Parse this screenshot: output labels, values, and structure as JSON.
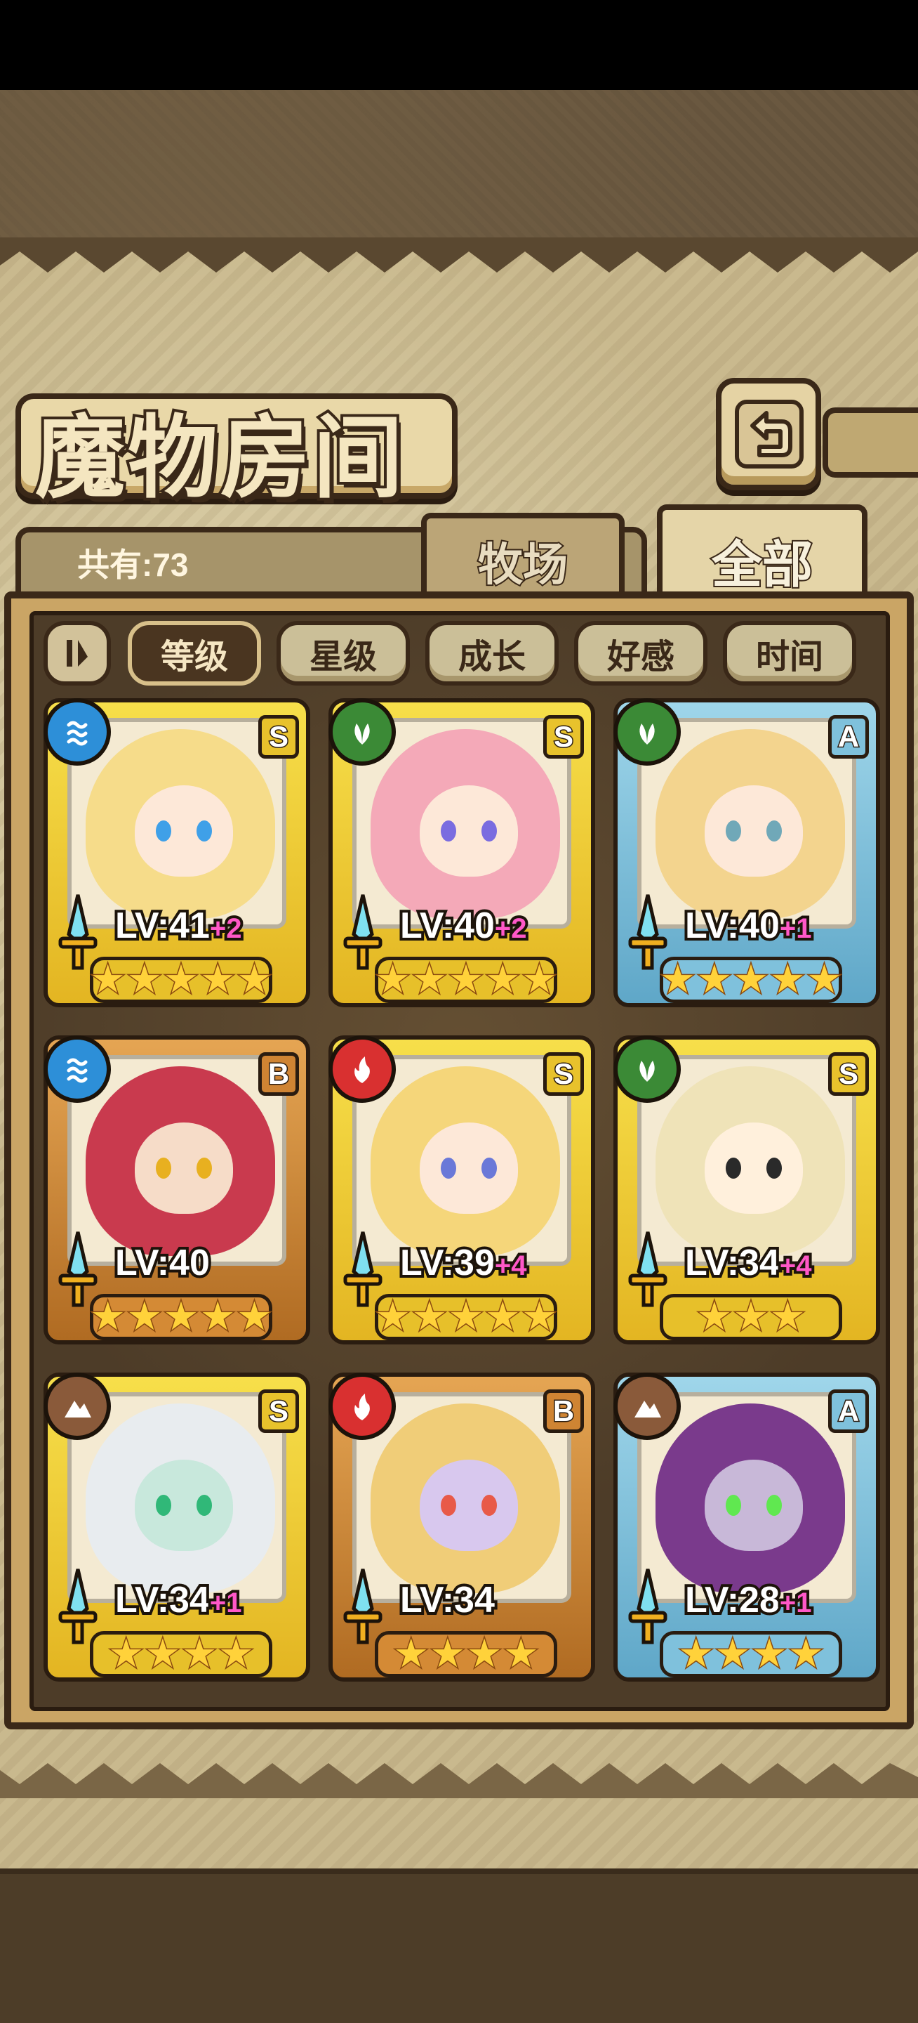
{
  "header": {
    "title": "魔物房间"
  },
  "tabs": [
    {
      "label": "牧场"
    },
    {
      "label": "全部"
    }
  ],
  "count_label": "共有:73",
  "sort_options": [
    {
      "label": "等级",
      "active": true
    },
    {
      "label": "星级",
      "active": false
    },
    {
      "label": "成长",
      "active": false
    },
    {
      "label": "好感",
      "active": false
    },
    {
      "label": "时间",
      "active": false
    }
  ],
  "monsters": [
    {
      "level": "LV:41",
      "bonus": "+2",
      "rank": "S",
      "element": "water",
      "stars": 5,
      "frame": "gold"
    },
    {
      "level": "LV:40",
      "bonus": "+2",
      "rank": "S",
      "element": "leaf",
      "stars": 5,
      "frame": "gold"
    },
    {
      "level": "LV:40",
      "bonus": "+1",
      "rank": "A",
      "element": "leaf",
      "stars": 5,
      "frame": "blue"
    },
    {
      "level": "LV:40",
      "bonus": "",
      "rank": "B",
      "element": "water",
      "stars": 5,
      "frame": "bronze"
    },
    {
      "level": "LV:39",
      "bonus": "+4",
      "rank": "S",
      "element": "fire",
      "stars": 5,
      "frame": "gold"
    },
    {
      "level": "LV:34",
      "bonus": "+4",
      "rank": "S",
      "element": "leaf",
      "stars": 3,
      "frame": "gold"
    },
    {
      "level": "LV:34",
      "bonus": "+1",
      "rank": "S",
      "element": "earth",
      "stars": 4,
      "frame": "gold"
    },
    {
      "level": "LV:34",
      "bonus": "",
      "rank": "B",
      "element": "fire",
      "stars": 4,
      "frame": "bronze"
    },
    {
      "level": "LV:28",
      "bonus": "+1",
      "rank": "A",
      "element": "earth",
      "stars": 4,
      "frame": "blue"
    }
  ]
}
